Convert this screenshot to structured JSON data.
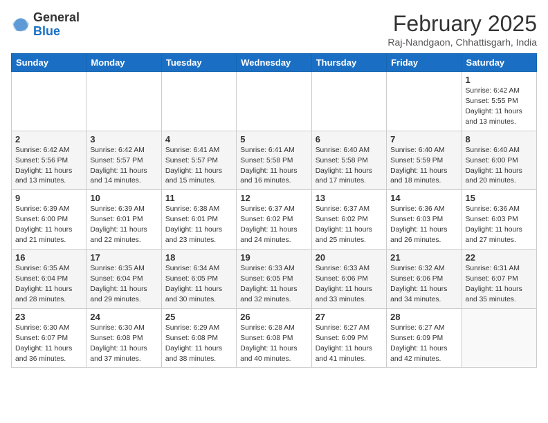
{
  "header": {
    "logo_general": "General",
    "logo_blue": "Blue",
    "month_title": "February 2025",
    "location": "Raj-Nandgaon, Chhattisgarh, India"
  },
  "weekdays": [
    "Sunday",
    "Monday",
    "Tuesday",
    "Wednesday",
    "Thursday",
    "Friday",
    "Saturday"
  ],
  "weeks": [
    [
      {
        "day": "",
        "info": ""
      },
      {
        "day": "",
        "info": ""
      },
      {
        "day": "",
        "info": ""
      },
      {
        "day": "",
        "info": ""
      },
      {
        "day": "",
        "info": ""
      },
      {
        "day": "",
        "info": ""
      },
      {
        "day": "1",
        "info": "Sunrise: 6:42 AM\nSunset: 5:55 PM\nDaylight: 11 hours\nand 13 minutes."
      }
    ],
    [
      {
        "day": "2",
        "info": "Sunrise: 6:42 AM\nSunset: 5:56 PM\nDaylight: 11 hours\nand 13 minutes."
      },
      {
        "day": "3",
        "info": "Sunrise: 6:42 AM\nSunset: 5:57 PM\nDaylight: 11 hours\nand 14 minutes."
      },
      {
        "day": "4",
        "info": "Sunrise: 6:41 AM\nSunset: 5:57 PM\nDaylight: 11 hours\nand 15 minutes."
      },
      {
        "day": "5",
        "info": "Sunrise: 6:41 AM\nSunset: 5:58 PM\nDaylight: 11 hours\nand 16 minutes."
      },
      {
        "day": "6",
        "info": "Sunrise: 6:40 AM\nSunset: 5:58 PM\nDaylight: 11 hours\nand 17 minutes."
      },
      {
        "day": "7",
        "info": "Sunrise: 6:40 AM\nSunset: 5:59 PM\nDaylight: 11 hours\nand 18 minutes."
      },
      {
        "day": "8",
        "info": "Sunrise: 6:40 AM\nSunset: 6:00 PM\nDaylight: 11 hours\nand 20 minutes."
      }
    ],
    [
      {
        "day": "9",
        "info": "Sunrise: 6:39 AM\nSunset: 6:00 PM\nDaylight: 11 hours\nand 21 minutes."
      },
      {
        "day": "10",
        "info": "Sunrise: 6:39 AM\nSunset: 6:01 PM\nDaylight: 11 hours\nand 22 minutes."
      },
      {
        "day": "11",
        "info": "Sunrise: 6:38 AM\nSunset: 6:01 PM\nDaylight: 11 hours\nand 23 minutes."
      },
      {
        "day": "12",
        "info": "Sunrise: 6:37 AM\nSunset: 6:02 PM\nDaylight: 11 hours\nand 24 minutes."
      },
      {
        "day": "13",
        "info": "Sunrise: 6:37 AM\nSunset: 6:02 PM\nDaylight: 11 hours\nand 25 minutes."
      },
      {
        "day": "14",
        "info": "Sunrise: 6:36 AM\nSunset: 6:03 PM\nDaylight: 11 hours\nand 26 minutes."
      },
      {
        "day": "15",
        "info": "Sunrise: 6:36 AM\nSunset: 6:03 PM\nDaylight: 11 hours\nand 27 minutes."
      }
    ],
    [
      {
        "day": "16",
        "info": "Sunrise: 6:35 AM\nSunset: 6:04 PM\nDaylight: 11 hours\nand 28 minutes."
      },
      {
        "day": "17",
        "info": "Sunrise: 6:35 AM\nSunset: 6:04 PM\nDaylight: 11 hours\nand 29 minutes."
      },
      {
        "day": "18",
        "info": "Sunrise: 6:34 AM\nSunset: 6:05 PM\nDaylight: 11 hours\nand 30 minutes."
      },
      {
        "day": "19",
        "info": "Sunrise: 6:33 AM\nSunset: 6:05 PM\nDaylight: 11 hours\nand 32 minutes."
      },
      {
        "day": "20",
        "info": "Sunrise: 6:33 AM\nSunset: 6:06 PM\nDaylight: 11 hours\nand 33 minutes."
      },
      {
        "day": "21",
        "info": "Sunrise: 6:32 AM\nSunset: 6:06 PM\nDaylight: 11 hours\nand 34 minutes."
      },
      {
        "day": "22",
        "info": "Sunrise: 6:31 AM\nSunset: 6:07 PM\nDaylight: 11 hours\nand 35 minutes."
      }
    ],
    [
      {
        "day": "23",
        "info": "Sunrise: 6:30 AM\nSunset: 6:07 PM\nDaylight: 11 hours\nand 36 minutes."
      },
      {
        "day": "24",
        "info": "Sunrise: 6:30 AM\nSunset: 6:08 PM\nDaylight: 11 hours\nand 37 minutes."
      },
      {
        "day": "25",
        "info": "Sunrise: 6:29 AM\nSunset: 6:08 PM\nDaylight: 11 hours\nand 38 minutes."
      },
      {
        "day": "26",
        "info": "Sunrise: 6:28 AM\nSunset: 6:08 PM\nDaylight: 11 hours\nand 40 minutes."
      },
      {
        "day": "27",
        "info": "Sunrise: 6:27 AM\nSunset: 6:09 PM\nDaylight: 11 hours\nand 41 minutes."
      },
      {
        "day": "28",
        "info": "Sunrise: 6:27 AM\nSunset: 6:09 PM\nDaylight: 11 hours\nand 42 minutes."
      },
      {
        "day": "",
        "info": ""
      }
    ]
  ]
}
